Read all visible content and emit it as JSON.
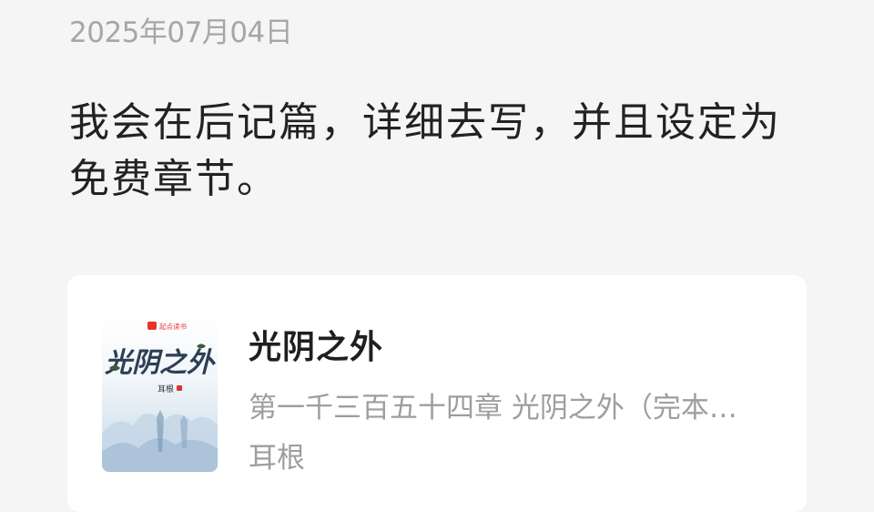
{
  "post": {
    "date": "2025年07月04日",
    "text": "我会在后记篇，详细去写，并且设定为免费章节。"
  },
  "book_card": {
    "cover": {
      "publisher_badge": "起点读书",
      "cover_title": "光阴之外",
      "cover_author": "耳根"
    },
    "title": "光阴之外",
    "latest_chapter": "第一千三百五十四章 光阴之外（完本感言）",
    "author": "耳根"
  }
}
